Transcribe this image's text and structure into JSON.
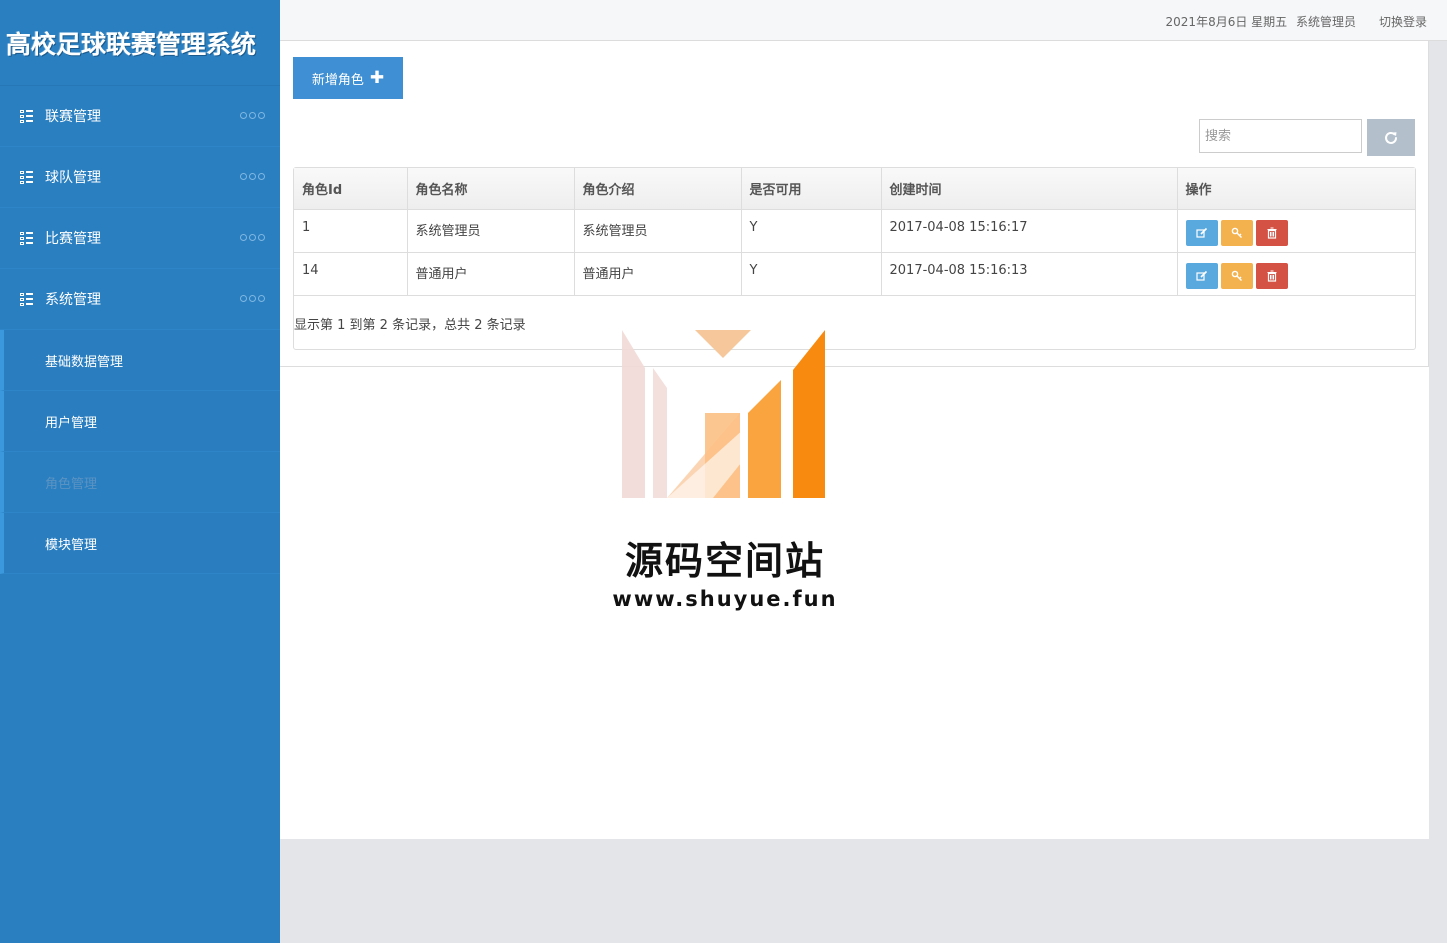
{
  "app": {
    "title": "高校足球联赛管理系统"
  },
  "topbar": {
    "date": "2021年8月6日 星期五",
    "user": "系统管理员",
    "switch_login": "切换登录"
  },
  "sidebar": {
    "items": [
      {
        "label": "联赛管理"
      },
      {
        "label": "球队管理"
      },
      {
        "label": "比赛管理"
      },
      {
        "label": "系统管理"
      }
    ],
    "sub_items": [
      {
        "label": "基础数据管理"
      },
      {
        "label": "用户管理"
      },
      {
        "label": "角色管理",
        "active": true
      },
      {
        "label": "模块管理"
      }
    ]
  },
  "toolbar": {
    "add_label": "新增角色",
    "search_placeholder": "搜索"
  },
  "table": {
    "headers": [
      "角色Id",
      "角色名称",
      "角色介绍",
      "是否可用",
      "创建时间",
      "操作"
    ],
    "rows": [
      {
        "id": "1",
        "name": "系统管理员",
        "intro": "系统管理员",
        "enabled": "Y",
        "created": "2017-04-08 15:16:17"
      },
      {
        "id": "14",
        "name": "普通用户",
        "intro": "普通用户",
        "enabled": "Y",
        "created": "2017-04-08 15:16:13"
      }
    ],
    "pager": "显示第 1 到第 2 条记录，总共 2 条记录"
  },
  "watermark": {
    "title": "源码空间站",
    "url": "www.shuyue.fun"
  },
  "colors": {
    "sidebar": "#2a7fc1",
    "primary_button": "#3e8fd3",
    "edit": "#5aa9de",
    "key": "#f4b24f",
    "delete": "#d35244"
  }
}
